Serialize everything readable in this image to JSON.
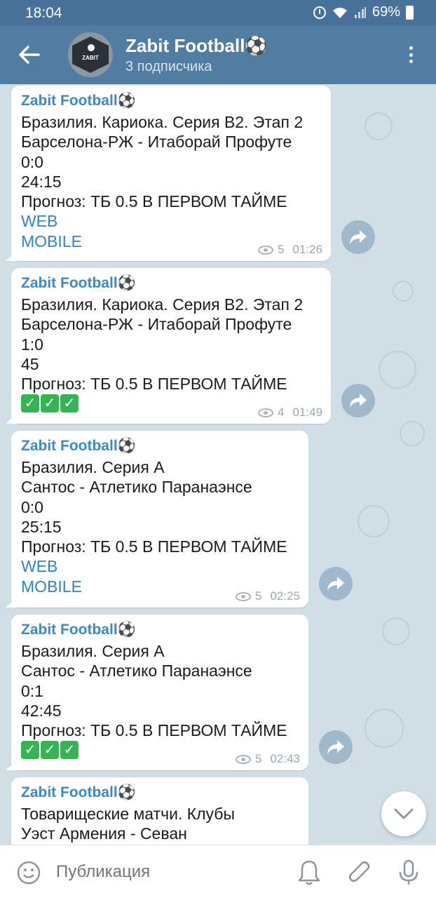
{
  "status_bar": {
    "time": "18:04",
    "battery": "69%"
  },
  "header": {
    "title": "Zabit Football⚽",
    "subtitle": "3 подписчика",
    "avatar_text": "ZABIT"
  },
  "messages": [
    {
      "author": "Zabit Football⚽",
      "lines": [
        "Бразилия. Кариока. Серия В2. Этап 2",
        "Барселона-РЖ - Итаборай Профуте",
        "0:0",
        "24:15",
        "Прогноз: ТБ 0.5 В ПЕРВОМ ТАЙМЕ"
      ],
      "links": [
        "WEB",
        "MOBILE"
      ],
      "views": "5",
      "time": "01:26"
    },
    {
      "author": "Zabit Football⚽",
      "lines": [
        "Бразилия. Кариока. Серия В2. Этап 2",
        "Барселона-РЖ - Итаборай Профуте",
        "1:0",
        "45",
        "Прогноз: ТБ 0.5 В ПЕРВОМ ТАЙМЕ"
      ],
      "checks": [
        "✓",
        "✓",
        "✓"
      ],
      "views": "4",
      "time": "01:49"
    },
    {
      "author": "Zabit Football⚽",
      "lines": [
        "Бразилия. Серия А",
        "Сантос - Атлетико Паранаэнсе",
        "0:0",
        "25:15",
        "Прогноз: ТБ 0.5 В ПЕРВОМ ТАЙМЕ"
      ],
      "links": [
        "WEB",
        "MOBILE"
      ],
      "views": "5",
      "time": "02:25"
    },
    {
      "author": "Zabit Football⚽",
      "lines": [
        "Бразилия. Серия А",
        "Сантос - Атлетико Паранаэнсе",
        "0:1",
        "42:45",
        "Прогноз: ТБ 0.5 В ПЕРВОМ ТАЙМЕ"
      ],
      "checks": [
        "✓",
        "✓",
        "✓"
      ],
      "views": "5",
      "time": "02:43"
    },
    {
      "author": "Zabit Football⚽",
      "lines": [
        "Товарищеские матчи. Клубы",
        "Уэст Армения - Севан"
      ]
    }
  ],
  "input_bar": {
    "placeholder": "Публикация"
  },
  "icons": {
    "back": "arrow-left-icon",
    "menu": "more-vertical-icon",
    "share": "share-icon",
    "views": "eye-icon",
    "scroll_down": "chevron-down-icon",
    "emoji": "smile-icon",
    "bell": "bell-icon",
    "attach": "paperclip-icon",
    "mic": "microphone-icon"
  },
  "colors": {
    "header": "#527da3",
    "status_bar": "#48729a",
    "author": "#3a8ac8",
    "link": "#2f84c6",
    "check": "#35b454"
  }
}
